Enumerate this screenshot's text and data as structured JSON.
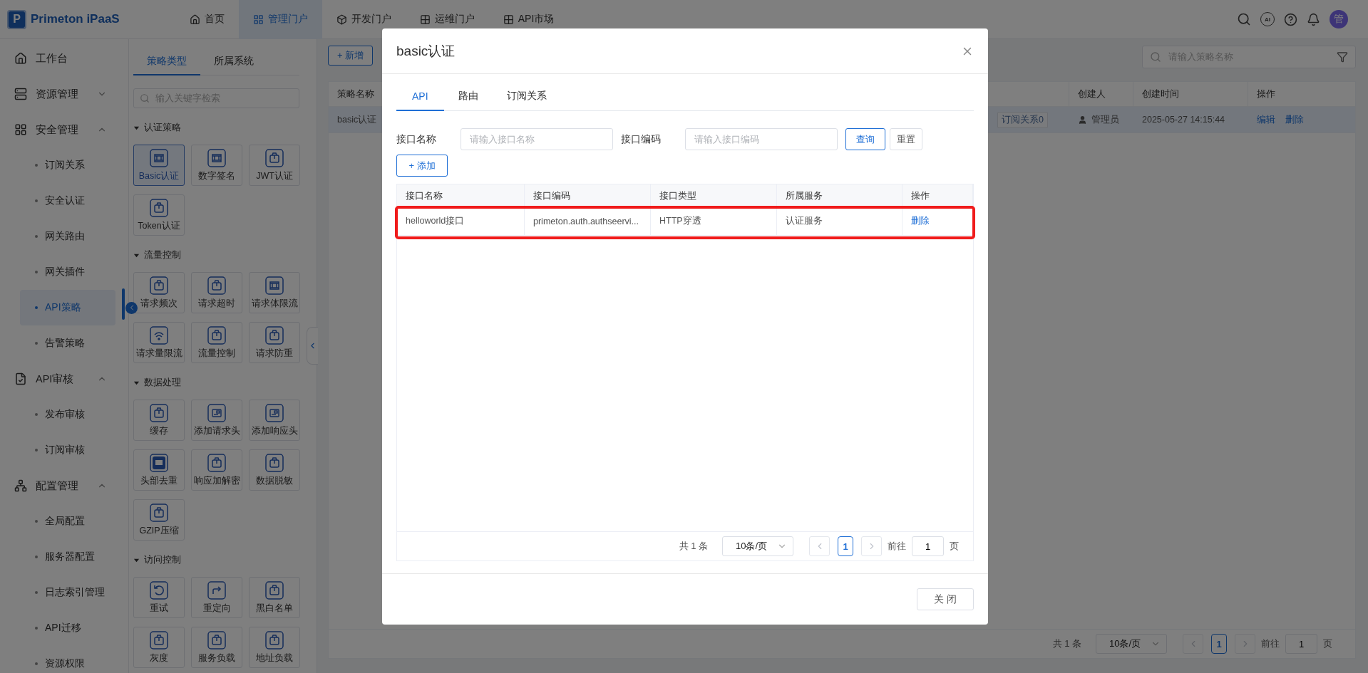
{
  "topbar": {
    "logo_letter": "P",
    "brand": "Primeton iPaaS",
    "nav": [
      {
        "label": "首页",
        "kind": "home",
        "selected": false
      },
      {
        "label": "管理门户",
        "kind": "grid",
        "selected": true
      },
      {
        "label": "开发门户",
        "kind": "cube",
        "selected": false
      },
      {
        "label": "运维门户",
        "kind": "apps",
        "selected": false
      },
      {
        "label": "API市场",
        "kind": "apps",
        "selected": false
      }
    ],
    "ai_label": "AI",
    "avatar": "管"
  },
  "sidebar": {
    "items": [
      {
        "label": "工作台",
        "kind": "home"
      },
      {
        "label": "资源管理",
        "kind": "server",
        "expanded": false
      },
      {
        "label": "安全管理",
        "kind": "grid",
        "expanded": true,
        "children": [
          {
            "label": "订阅关系",
            "selected": false
          },
          {
            "label": "安全认证",
            "selected": false
          },
          {
            "label": "网关路由",
            "selected": false
          },
          {
            "label": "网关插件",
            "selected": false
          },
          {
            "label": "API策略",
            "selected": true
          },
          {
            "label": "告警策略",
            "selected": false
          }
        ]
      },
      {
        "label": "API审核",
        "kind": "review",
        "expanded": true,
        "children": [
          {
            "label": "发布审核",
            "selected": false
          },
          {
            "label": "订阅审核",
            "selected": false
          }
        ]
      },
      {
        "label": "配置管理",
        "kind": "org",
        "expanded": true,
        "children": [
          {
            "label": "全局配置",
            "selected": false
          },
          {
            "label": "服务器配置",
            "selected": false
          },
          {
            "label": "日志索引管理",
            "selected": false
          },
          {
            "label": "API迁移",
            "selected": false
          },
          {
            "label": "资源权限",
            "selected": false
          }
        ]
      }
    ]
  },
  "policy_panel": {
    "tabs": [
      {
        "label": "策略类型",
        "selected": true
      },
      {
        "label": "所属系统",
        "selected": false
      }
    ],
    "search": {
      "placeholder": "输入关键字检索"
    },
    "sections": [
      {
        "title": "认证策略",
        "expanded": true,
        "tiles": [
          {
            "label": "Basic认证",
            "kind": "film",
            "selected": true
          },
          {
            "label": "数字签名",
            "kind": "film",
            "selected": false
          },
          {
            "label": "JWT认证",
            "kind": "box",
            "selected": false
          },
          {
            "label": "Token认证",
            "kind": "box",
            "selected": false
          }
        ]
      },
      {
        "title": "流量控制",
        "expanded": true,
        "tiles": [
          {
            "label": "请求频次",
            "kind": "box",
            "selected": false
          },
          {
            "label": "请求超时",
            "kind": "box",
            "selected": false
          },
          {
            "label": "请求体限流",
            "kind": "film",
            "selected": false
          },
          {
            "label": "请求量限流",
            "kind": "wifi",
            "selected": false
          },
          {
            "label": "流量控制",
            "kind": "box",
            "selected": false
          },
          {
            "label": "请求防重",
            "kind": "box",
            "selected": false
          }
        ]
      },
      {
        "title": "数据处理",
        "expanded": true,
        "tiles": [
          {
            "label": "缓存",
            "kind": "box",
            "selected": false
          },
          {
            "label": "添加请求头",
            "kind": "card",
            "selected": false
          },
          {
            "label": "添加响应头",
            "kind": "card",
            "selected": false
          },
          {
            "label": "头部去重",
            "kind": "mail",
            "selected": false
          },
          {
            "label": "响应加解密",
            "kind": "box",
            "selected": false
          },
          {
            "label": "数据脱敏",
            "kind": "box",
            "selected": false
          },
          {
            "label": "GZIP压缩",
            "kind": "box",
            "selected": false
          }
        ]
      },
      {
        "title": "访问控制",
        "expanded": true,
        "tiles": [
          {
            "label": "重试",
            "kind": "retry",
            "selected": false
          },
          {
            "label": "重定向",
            "kind": "redirect",
            "selected": false
          },
          {
            "label": "黑白名单",
            "kind": "box",
            "selected": false
          },
          {
            "label": "灰度",
            "kind": "box",
            "selected": false
          },
          {
            "label": "服务负载",
            "kind": "box",
            "selected": false
          },
          {
            "label": "地址负载",
            "kind": "box",
            "selected": false
          }
        ]
      }
    ]
  },
  "main": {
    "add_button": "+ 新增",
    "search": {
      "placeholder": "请输入策略名称"
    },
    "table": {
      "columns": [
        "策略名称",
        "创建人",
        "创建时间",
        "操作"
      ],
      "rows": [
        {
          "name": "basic认证",
          "tag": "订阅关系0",
          "creator": "管理员",
          "created": "2025-05-27 14:15:44",
          "actions": [
            "编辑",
            "删除"
          ],
          "selected": true
        }
      ]
    },
    "pagination": {
      "total": "共 1 条",
      "page_size": "10条/页",
      "pages": [
        {
          "label": "1",
          "selected": true
        }
      ],
      "goto": "前往",
      "goto_value": "1",
      "suffix": "页"
    }
  },
  "modal": {
    "title": "basic认证",
    "tabs": [
      {
        "label": "API",
        "selected": true
      },
      {
        "label": "路由",
        "selected": false
      },
      {
        "label": "订阅关系",
        "selected": false
      }
    ],
    "filters": [
      {
        "label": "接口名称",
        "placeholder": "请输入接口名称"
      },
      {
        "label": "接口编码",
        "placeholder": "请输入接口编码"
      }
    ],
    "query_button": "查询",
    "reset_button": "重置",
    "add_button": "+ 添加",
    "table": {
      "columns": [
        "接口名称",
        "接口编码",
        "接口类型",
        "所属服务",
        "操作"
      ],
      "rows": [
        {
          "cells": [
            "helloworld接口",
            "primeton.auth.authseervi...",
            "HTTP穿透",
            "认证服务"
          ],
          "action": "删除",
          "highlighted": true
        }
      ]
    },
    "pagination": {
      "total": "共 1 条",
      "page_size": "10条/页",
      "pages": [
        {
          "label": "1",
          "selected": true
        }
      ],
      "goto": "前往",
      "goto_value": "1",
      "suffix": "页"
    },
    "close_button": "关 闭"
  }
}
